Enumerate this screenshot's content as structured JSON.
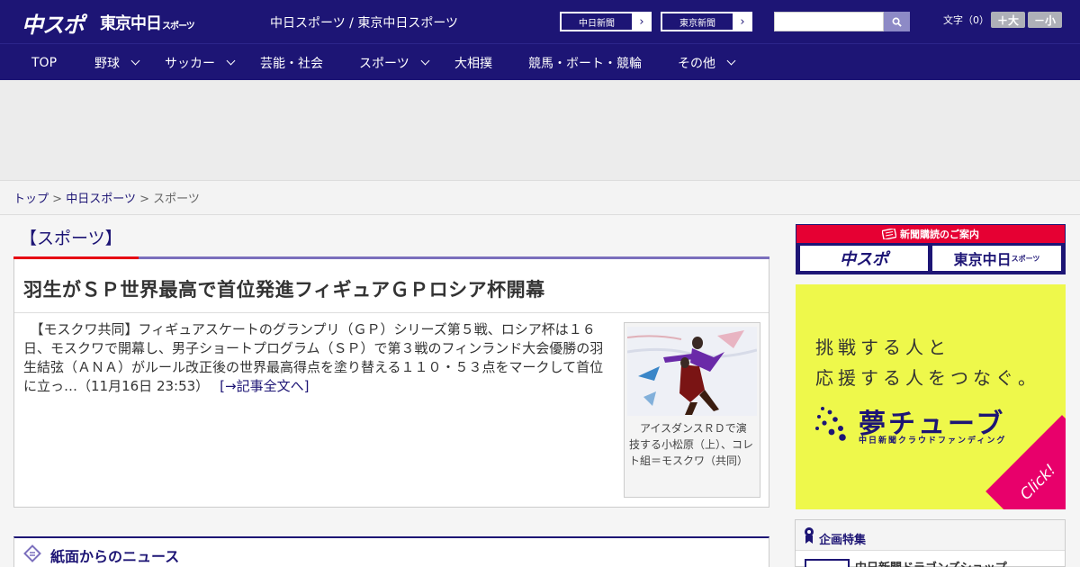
{
  "header": {
    "logo_chuspo": "中スポ",
    "logo_tokyo": "東京中日",
    "logo_tokyo_suffix": "スポーツ",
    "site_title": "中日スポーツ / 東京中日スポーツ",
    "paper_buttons": [
      "中日新聞",
      "東京新聞"
    ],
    "search_placeholder": "",
    "font_label": "文字（0）",
    "font_bigger": "＋大",
    "font_smaller": "－小"
  },
  "nav": {
    "items": [
      {
        "label": "TOP",
        "has_menu": false
      },
      {
        "label": "野球",
        "has_menu": true
      },
      {
        "label": "サッカー",
        "has_menu": true
      },
      {
        "label": "芸能・社会",
        "has_menu": false
      },
      {
        "label": "スポーツ",
        "has_menu": true
      },
      {
        "label": "大相撲",
        "has_menu": false
      },
      {
        "label": "競馬・ボート・競輪",
        "has_menu": false
      },
      {
        "label": "その他",
        "has_menu": true
      }
    ]
  },
  "breadcrumb": {
    "items": [
      "トップ",
      "中日スポーツ",
      "スポーツ"
    ],
    "separator": ">"
  },
  "section": {
    "title": "【スポーツ】"
  },
  "article": {
    "headline": "羽生がＳＰ世界最高で首位発進フィギュアＧＰロシア杯開幕",
    "body": "　【モスクワ共同】フィギュアスケートのグランプリ（ＧＰ）シリーズ第５戦、ロシア杯は１６日、モスクワで開幕し、男子ショートプログラム（ＳＰ）で第３戦のフィンランド大会優勝の羽生結弦（ＡＮＡ）がルール改正後の世界最高得点を塗り替える１１０・５３点をマークして首位に立っ…（11月16日 23:53）",
    "read_more": "[→記事全文へ]",
    "photo_caption": "　アイスダンスＲＤで演技する小松原（上）、コレト組＝モスクワ（共同）"
  },
  "news_section": {
    "title": "紙面からのニュース"
  },
  "sidebar": {
    "subscription_title": "新聞購読のご案内",
    "subscription_logos": [
      "中スポ",
      "東京中日"
    ],
    "subscription_logo_suffix": "スポーツ",
    "ad_line1": "挑戦する人と",
    "ad_line2": "応援する人をつなぐ。",
    "ad_brand": "夢チューブ",
    "ad_brand_sub": "中日新聞クラウドファンディング",
    "ad_click": "Click!",
    "feature_title": "企画特集",
    "feature_item": "中日新聞ドラゴンズショップ"
  },
  "colors": {
    "brand_navy": "#1d1575",
    "accent_red": "#e60012",
    "ad_yellow": "#eef84b",
    "ad_pink": "#e8006b"
  }
}
